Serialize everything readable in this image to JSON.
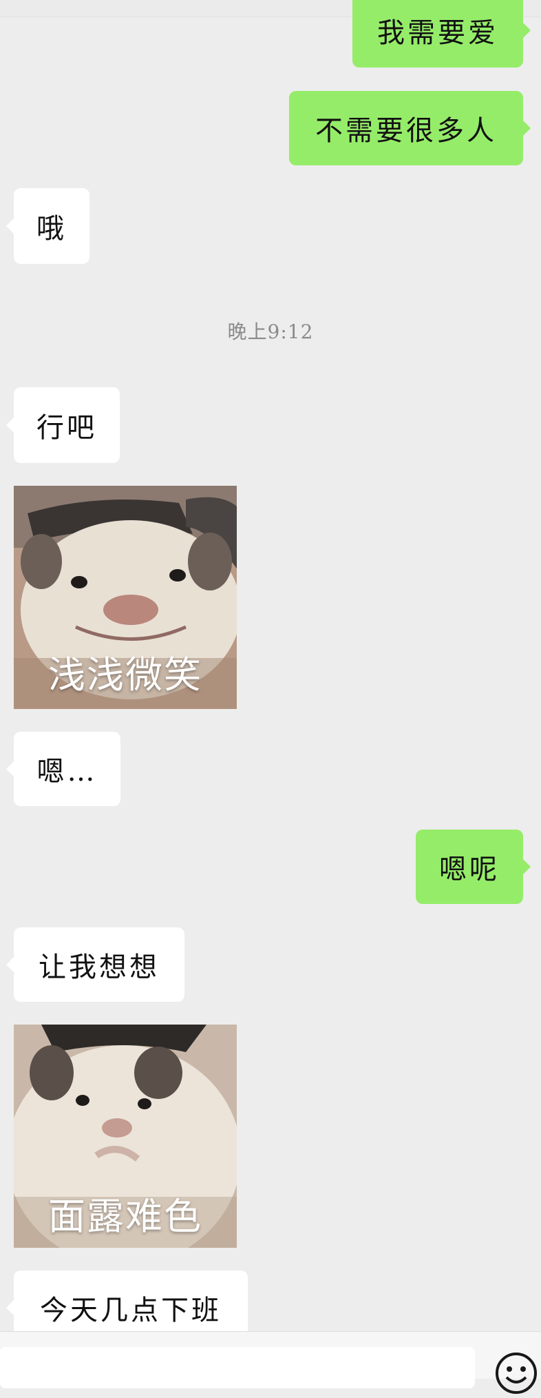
{
  "messages": [
    {
      "type": "text",
      "side": "out",
      "text": "我需要爱"
    },
    {
      "type": "text",
      "side": "out",
      "text": "不需要很多人"
    },
    {
      "type": "text",
      "side": "in",
      "text": "哦"
    },
    {
      "type": "timestamp",
      "text": "晚上9:12"
    },
    {
      "type": "text",
      "side": "in",
      "text": "行吧"
    },
    {
      "type": "sticker",
      "side": "in",
      "caption": "浅浅微笑"
    },
    {
      "type": "text",
      "side": "in",
      "text": "嗯…"
    },
    {
      "type": "text",
      "side": "out",
      "text": "嗯呢"
    },
    {
      "type": "text",
      "side": "in",
      "text": "让我想想"
    },
    {
      "type": "sticker",
      "side": "in",
      "caption": "面露难色"
    },
    {
      "type": "text",
      "side": "in",
      "text": "今天几点下班"
    }
  ],
  "input": {
    "value": "",
    "placeholder": ""
  },
  "icons": {
    "emoji": "smiley-face-icon"
  },
  "colors": {
    "background": "#ededed",
    "incoming_bubble": "#ffffff",
    "outgoing_bubble": "#95ec69"
  }
}
